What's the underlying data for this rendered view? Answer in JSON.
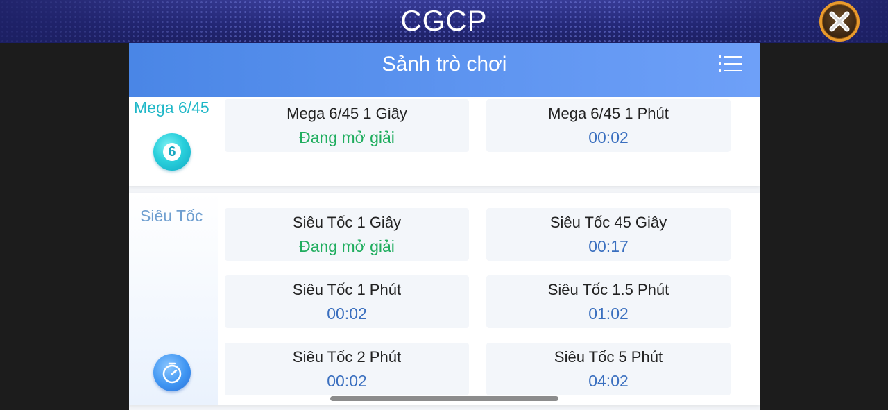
{
  "app": {
    "title": "CGCP"
  },
  "panel": {
    "title": "Sảnh trò chơi"
  },
  "categories": [
    {
      "label": "Mega 6/45",
      "icon_number": "6",
      "games": [
        {
          "name": "Mega 6/45 1 Giây",
          "status": "Đang mở giải"
        },
        {
          "name": "Mega 6/45 1 Phút",
          "status": "00:02"
        }
      ]
    },
    {
      "label": "Siêu Tốc",
      "games": [
        {
          "name": "Siêu Tốc 1 Giây",
          "status": "Đang mở giải"
        },
        {
          "name": "Siêu Tốc 45 Giây",
          "status": "00:17"
        },
        {
          "name": "Siêu Tốc 1 Phút",
          "status": "00:02"
        },
        {
          "name": "Siêu Tốc 1.5 Phút",
          "status": "01:02"
        },
        {
          "name": "Siêu Tốc 2 Phút",
          "status": "00:02"
        },
        {
          "name": "Siêu Tốc 5 Phút",
          "status": "04:02"
        }
      ]
    }
  ],
  "colors": {
    "open_status": "#1fad5e",
    "timer_status": "#3a6fbf",
    "header_gradient_start": "#4a86e6",
    "header_gradient_end": "#6ea0f8",
    "close_ring": "#e89a2c"
  },
  "icons": {
    "close": "close-icon",
    "menu": "menu-icon",
    "mega": "number-ball-icon",
    "sieu": "stopwatch-icon"
  }
}
